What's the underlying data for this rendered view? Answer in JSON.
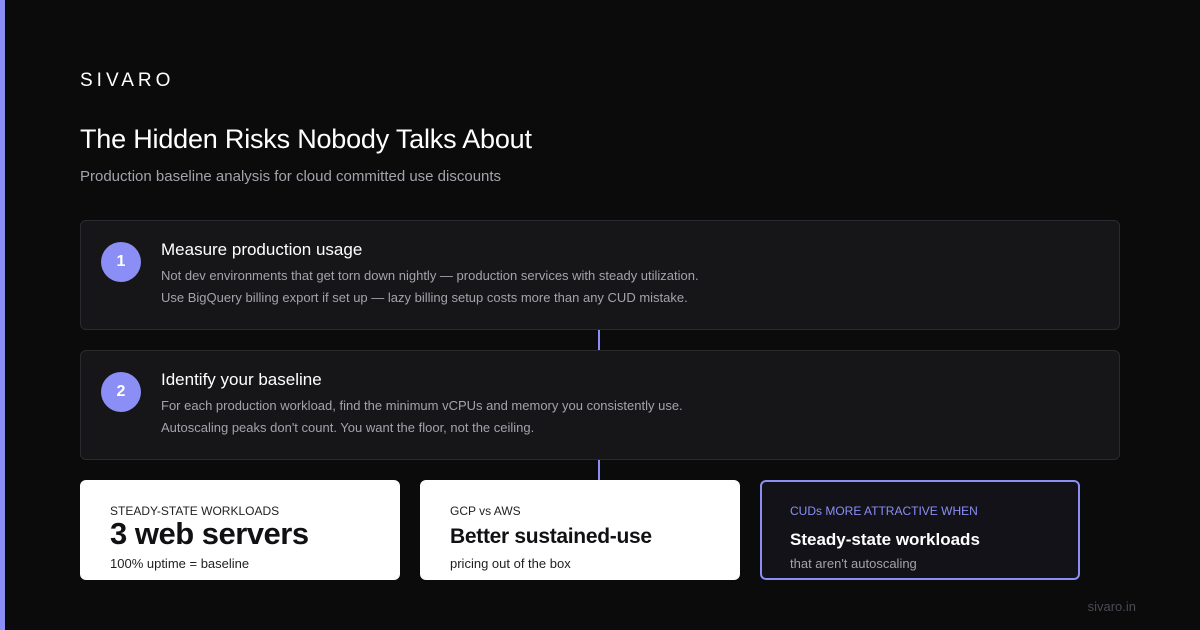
{
  "colors": {
    "accent": "#8b8ff5",
    "background": "#0b0b0c",
    "card": "#161619",
    "muted_text": "#a3a3ab"
  },
  "brand": "SIVARO",
  "header": {
    "title": "The Hidden Risks Nobody Talks About",
    "subtitle": "Production baseline analysis for cloud committed use discounts"
  },
  "steps": [
    {
      "number": "1",
      "title": "Measure production usage",
      "lines": [
        "Not dev environments that get torn down nightly — production services with steady utilization.",
        "Use BigQuery billing export if set up — lazy billing setup costs more than any CUD mistake."
      ]
    },
    {
      "number": "2",
      "title": "Identify your baseline",
      "lines": [
        "For each production workload, find the minimum vCPUs and memory you consistently use.",
        "Autoscaling peaks don't count. You want the floor, not the ceiling."
      ]
    }
  ],
  "stats": [
    {
      "label": "STEADY-STATE WORKLOADS",
      "value": "3 web servers",
      "note": "100% uptime = baseline"
    },
    {
      "label": "GCP vs AWS",
      "value": "Better sustained-use",
      "note": "pricing out of the box"
    },
    {
      "label": "CUDs MORE ATTRACTIVE WHEN",
      "value": "Steady-state workloads",
      "note": "that aren't autoscaling"
    }
  ],
  "footer": {
    "url": "sivaro.in"
  }
}
